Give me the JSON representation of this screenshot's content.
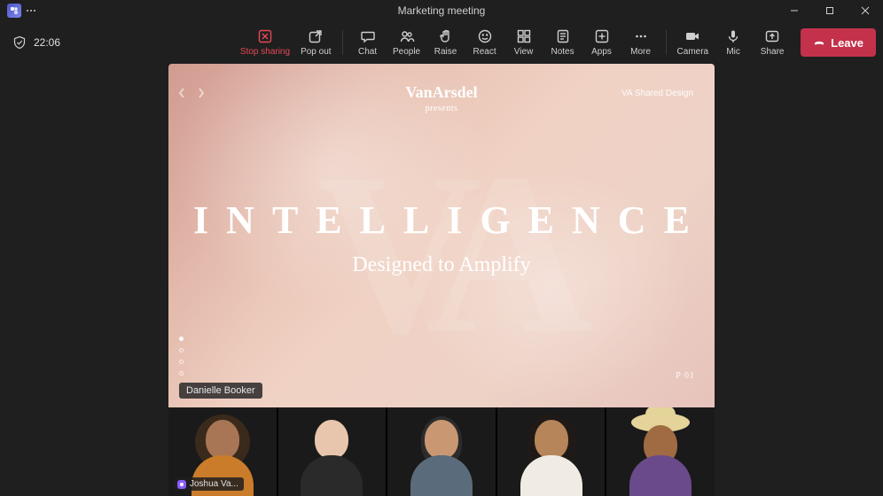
{
  "titlebar": {
    "title": "Marketing meeting"
  },
  "status": {
    "time": "22:06"
  },
  "toolbar": {
    "stop_sharing": "Stop sharing",
    "pop_out": "Pop out",
    "chat": "Chat",
    "people": "People",
    "raise": "Raise",
    "react": "React",
    "view": "View",
    "notes": "Notes",
    "apps": "Apps",
    "more": "More",
    "camera": "Camera",
    "mic": "Mic",
    "share": "Share",
    "leave": "Leave"
  },
  "slide": {
    "brand": "VanArsdel",
    "presents": "presents",
    "shared_design": "VA Shared Design",
    "headline": "INTELLIGENCE",
    "subline": "Designed to Amplify",
    "page": "P 01",
    "presenter": "Danielle Booker"
  },
  "gallery": {
    "speaking_name": "Joshua Va..."
  }
}
